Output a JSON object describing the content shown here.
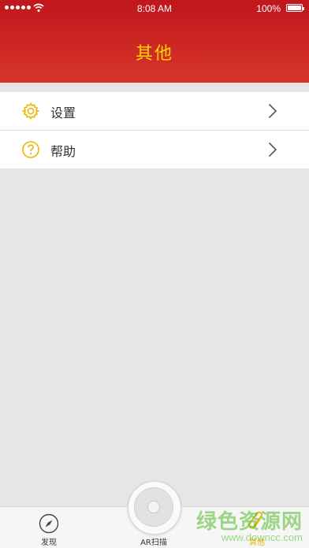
{
  "status_bar": {
    "time": "8:08 AM",
    "battery": "100%"
  },
  "header": {
    "title": "其他"
  },
  "menu": {
    "items": [
      {
        "label": "设置",
        "icon": "gear-icon"
      },
      {
        "label": "帮助",
        "icon": "help-icon"
      }
    ]
  },
  "tabbar": {
    "discover": "发现",
    "ar": "AR扫描",
    "other": "其他"
  },
  "watermark": {
    "line1": "绿色资源网",
    "line2": "www.downcc.com"
  },
  "colors": {
    "header_top": "#c0161c",
    "header_bottom": "#d7352a",
    "accent_yellow": "#ffd400",
    "icon_yellow": "#e8b800"
  }
}
